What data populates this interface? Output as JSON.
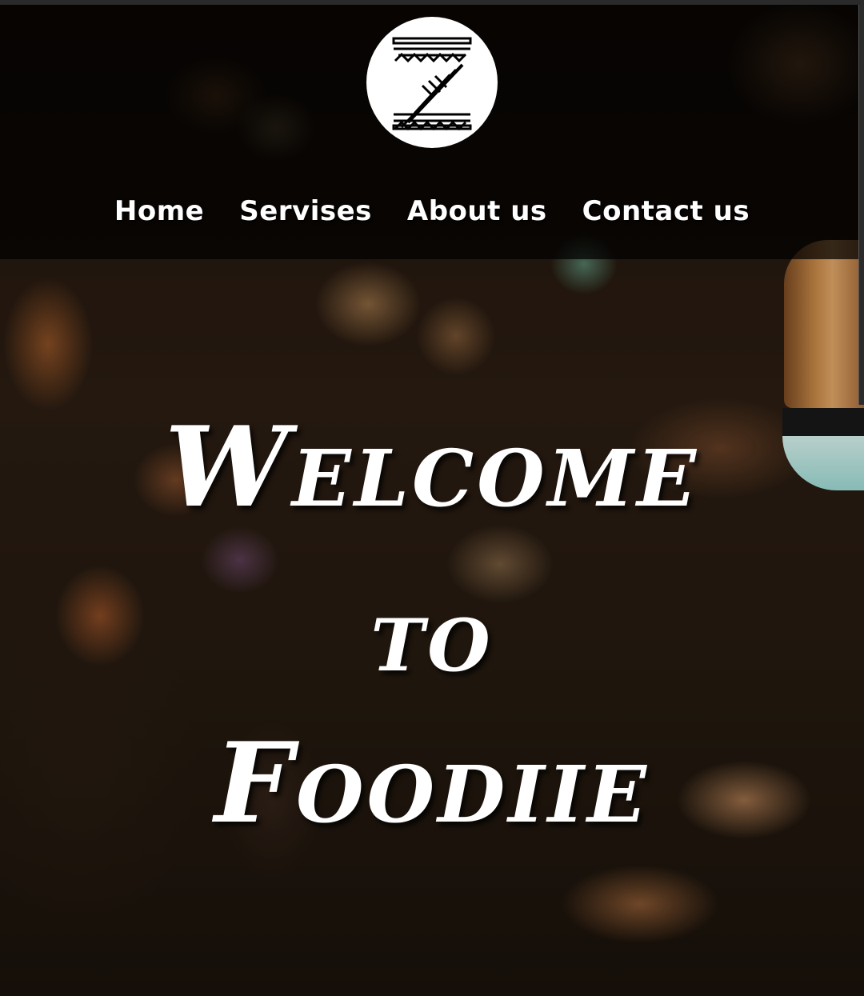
{
  "header": {
    "logo": {
      "icon": "foodiie-z-logo-icon"
    },
    "nav": {
      "items": [
        {
          "label": "Home"
        },
        {
          "label": "Servises"
        },
        {
          "label": "About us"
        },
        {
          "label": "Contact us"
        }
      ]
    }
  },
  "hero": {
    "line1": "Welcome",
    "line2": "to",
    "line3": "Foodiie"
  },
  "colors": {
    "header_bg": "#000000",
    "text": "#ffffff",
    "logo_bg": "#ffffff"
  }
}
